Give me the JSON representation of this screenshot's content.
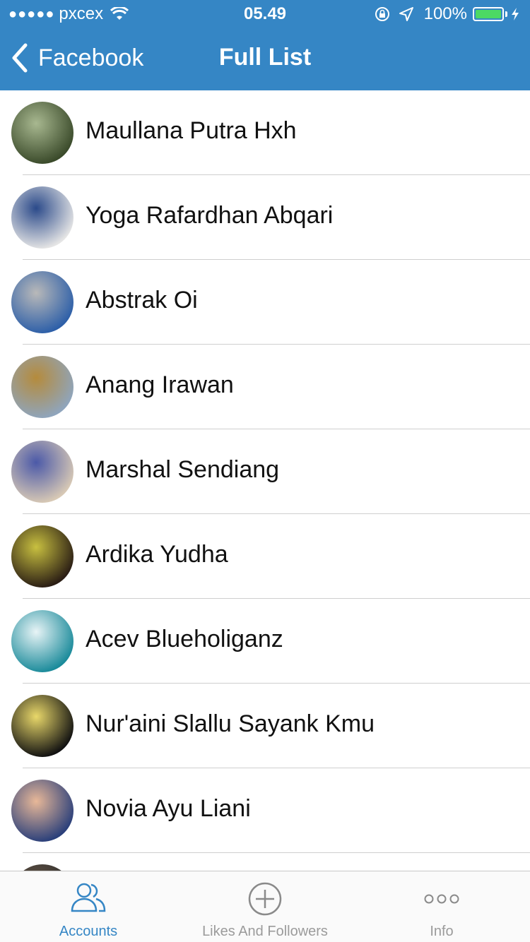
{
  "status_bar": {
    "carrier": "pxcex",
    "time": "05.49",
    "battery_percent": "100%",
    "battery_level": 1.0,
    "icons": [
      "signal-dots-icon",
      "wifi-icon",
      "rotation-lock-icon",
      "location-arrow-icon",
      "battery-icon",
      "charging-bolt-icon"
    ]
  },
  "nav": {
    "back_label": "Facebook",
    "title": "Full List",
    "back_icon": "chevron-left-icon"
  },
  "accounts": [
    {
      "name": "Maullana Putra Hxh",
      "avatar_colors": [
        "#3a4a2a",
        "#a8b890"
      ]
    },
    {
      "name": "Yoga Rafardhan Abqari",
      "avatar_colors": [
        "#e5e5e5",
        "#2b4a8a"
      ]
    },
    {
      "name": "Abstrak Oi",
      "avatar_colors": [
        "#2d5fa8",
        "#b9b9b9"
      ]
    },
    {
      "name": "Anang Irawan",
      "avatar_colors": [
        "#8fa5bd",
        "#b58b3c"
      ]
    },
    {
      "name": "Marshal Sendiang",
      "avatar_colors": [
        "#d8c9b5",
        "#4b59a8"
      ]
    },
    {
      "name": "Ardika Yudha",
      "avatar_colors": [
        "#2a1d14",
        "#c8c040"
      ]
    },
    {
      "name": "Acev Blueholiganz",
      "avatar_colors": [
        "#1a8a9a",
        "#e8f4f6"
      ]
    },
    {
      "name": "Nur'aini Slallu Sayank Kmu",
      "avatar_colors": [
        "#111111",
        "#e9d86a"
      ]
    },
    {
      "name": "Novia Ayu Liani",
      "avatar_colors": [
        "#2a3f7a",
        "#e8b898"
      ]
    }
  ],
  "tabs": [
    {
      "label": "Accounts",
      "icon": "users-icon",
      "active": true
    },
    {
      "label": "Likes And Followers",
      "icon": "plus-circle-icon",
      "active": false
    },
    {
      "label": "Info",
      "icon": "more-dots-icon",
      "active": false
    }
  ],
  "colors": {
    "header": "#3586c5",
    "active_tab": "#3586c5",
    "inactive_tab": "#9b9b9b",
    "battery": "#4cd964"
  }
}
